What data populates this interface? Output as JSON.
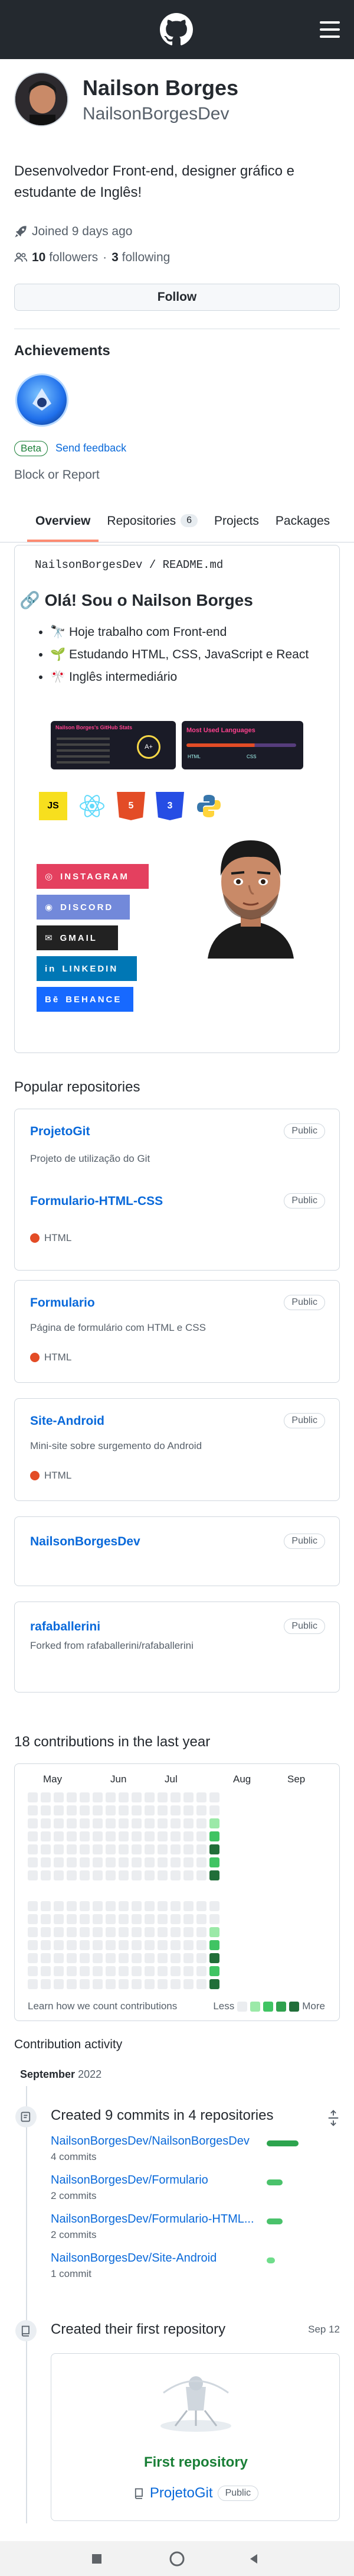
{
  "profile": {
    "name": "Nailson Borges",
    "login": "NailsonBorgesDev",
    "bio": "Desenvolvedor Front-end, designer gráfico e estudante de Inglês!",
    "joined": "Joined 9 days ago",
    "followers_count": "10",
    "followers_label": "followers",
    "dot": "·",
    "following_count": "3",
    "following_label": "following",
    "follow_button": "Follow"
  },
  "achievements": {
    "heading": "Achievements",
    "beta_label": "Beta",
    "feedback_link": "Send feedback",
    "block_report": "Block or Report"
  },
  "tabs": [
    {
      "label": "Overview",
      "active": true
    },
    {
      "label": "Repositories",
      "count": "6"
    },
    {
      "label": "Projects"
    },
    {
      "label": "Packages"
    }
  ],
  "readme": {
    "path_owner": "NailsonBorgesDev",
    "path_sep": " / ",
    "path_file": "README.md",
    "heading": "Olá! Sou o Nailson Borges",
    "items": [
      "🔭 Hoje trabalho com Front-end",
      "🌱 Estudando HTML, CSS, JavaScript e React",
      "🎌 Inglês intermediário"
    ],
    "stats_title": "Nailson Borges's GitHub Stats",
    "stats_grade": "A+",
    "langs_title": "Most Used Languages",
    "langs": [
      "HTML",
      "CSS"
    ],
    "tech_icons": [
      "javascript-icon",
      "react-icon",
      "html5-icon",
      "css3-icon",
      "python-icon"
    ],
    "socials": [
      {
        "label": "INSTAGRAM",
        "color": "#e4405f"
      },
      {
        "label": "DISCORD",
        "color": "#7289da"
      },
      {
        "label": "GMAIL",
        "color": "#222222"
      },
      {
        "label": "LINKEDIN",
        "color": "#0077b5"
      },
      {
        "label": "BEHANCE",
        "color": "#1769ff"
      }
    ]
  },
  "popular": {
    "heading": "Popular repositories",
    "public_label": "Public",
    "repos": [
      {
        "name": "ProjetoGit",
        "desc": "Projeto de utilização do Git",
        "lang": ""
      },
      {
        "name": "Formulario-HTML-CSS",
        "desc": "",
        "lang": "HTML"
      },
      {
        "name": "Formulario",
        "desc": "Página de formulário com HTML e CSS",
        "lang": "HTML"
      },
      {
        "name": "Site-Android",
        "desc": "Mini-site sobre surgemento do Android",
        "lang": "HTML"
      },
      {
        "name": "NailsonBorgesDev",
        "desc": "",
        "lang": ""
      },
      {
        "name": "rafaballerini",
        "desc": "Forked from rafaballerini/rafaballerini",
        "lang": ""
      }
    ]
  },
  "contributions": {
    "heading": "18 contributions in the last year",
    "months": [
      "May",
      "Jun",
      "Jul",
      "Aug",
      "Sep"
    ],
    "learn": "Learn how we count contributions",
    "less": "Less",
    "more": "More",
    "scale_colors": [
      "#ebedf0",
      "#9be9a8",
      "#40c463",
      "#30a14e",
      "#216e39"
    ]
  },
  "activity": {
    "heading": "Contribution activity",
    "month": "September",
    "year": "2022",
    "commits_title": "Created 9 commits in 4 repositories",
    "commits": [
      {
        "repo": "NailsonBorgesDev/NailsonBorgesDev",
        "count": "4 commits",
        "share": 1.0
      },
      {
        "repo": "NailsonBorgesDev/Formulario",
        "count": "2 commits",
        "share": 0.5
      },
      {
        "repo": "NailsonBorgesDev/Formulario-HTML...",
        "count": "2 commits",
        "share": 0.5
      },
      {
        "repo": "NailsonBorgesDev/Site-Android",
        "count": "1 commit",
        "share": 0.25
      }
    ],
    "first_repo_title": "Created their first repository",
    "first_repo_date": "Sep 12",
    "first_repo_label": "First repository",
    "first_repo_name": "ProjetoGit",
    "first_repo_vis": "Public"
  }
}
